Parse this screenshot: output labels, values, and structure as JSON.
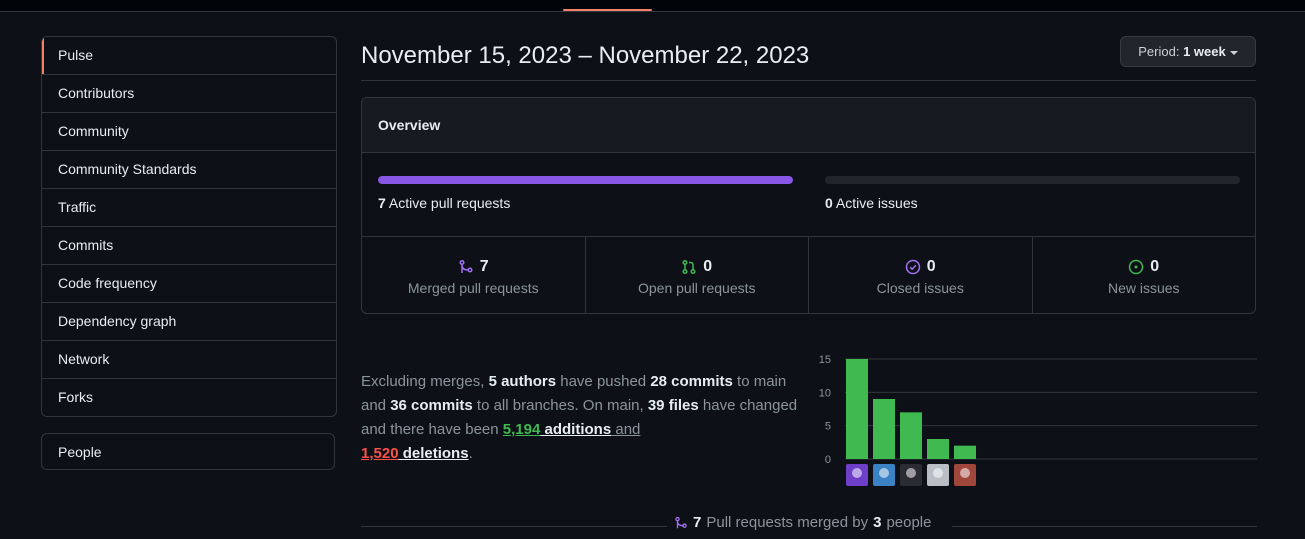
{
  "sidebar": {
    "items": [
      {
        "label": "Pulse",
        "active": true
      },
      {
        "label": "Contributors"
      },
      {
        "label": "Community"
      },
      {
        "label": "Community Standards"
      },
      {
        "label": "Traffic"
      },
      {
        "label": "Commits"
      },
      {
        "label": "Code frequency"
      },
      {
        "label": "Dependency graph"
      },
      {
        "label": "Network"
      },
      {
        "label": "Forks"
      }
    ],
    "people": "People"
  },
  "header": {
    "date_range": "November 15, 2023 – November 22, 2023",
    "period_prefix": "Period:",
    "period_value": "1 week"
  },
  "overview": {
    "title": "Overview",
    "active_prs": {
      "count": "7",
      "label": "Active pull requests",
      "fill_fraction": 1.0,
      "color": "#8957e5"
    },
    "active_issues": {
      "count": "0",
      "label": "Active issues",
      "fill_fraction": 0.0
    },
    "stats": [
      {
        "icon": "git-merge-icon",
        "count": "7",
        "label": "Merged pull requests",
        "color": "#a371f7"
      },
      {
        "icon": "git-pull-request-icon",
        "count": "0",
        "label": "Open pull requests",
        "color": "#3fb950"
      },
      {
        "icon": "issue-closed-icon",
        "count": "0",
        "label": "Closed issues",
        "color": "#a371f7"
      },
      {
        "icon": "issue-opened-icon",
        "count": "0",
        "label": "New issues",
        "color": "#3fb950"
      }
    ]
  },
  "summary": {
    "t1": "Excluding merges, ",
    "authors": "5 authors",
    "t2": " have pushed ",
    "commits_main": "28 commits",
    "t3": " to main and ",
    "commits_all": "36 commits",
    "t4": " to all branches. On main, ",
    "files": "39 files",
    "t5": " have changed and there have been ",
    "additions_num": "5,194",
    "additions_word": " additions",
    "t6": " and",
    "deletions_num": "1,520",
    "deletions_word": " deletions",
    "t7": "."
  },
  "chart_data": {
    "type": "bar",
    "categories": [
      "author-1",
      "author-2",
      "author-3",
      "author-4",
      "author-5"
    ],
    "values": [
      15,
      9,
      7,
      3,
      2
    ],
    "ylim": [
      0,
      15
    ],
    "yticks": [
      "0",
      "5",
      "10",
      "15"
    ],
    "bar_color": "#3fb950",
    "grid": true
  },
  "bottom": {
    "count": "7",
    "t1": "Pull requests merged by",
    "people_count": "3",
    "t2": "people"
  }
}
